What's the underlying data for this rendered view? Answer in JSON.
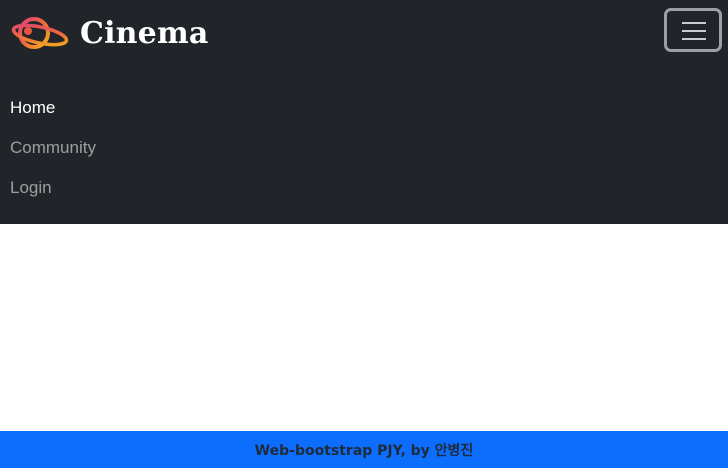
{
  "navbar": {
    "brand_name": "Cinema",
    "logo_icon": "planet-logo-icon",
    "toggler_icon": "hamburger-menu-icon",
    "items": [
      {
        "label": "Home",
        "active": true
      },
      {
        "label": "Community",
        "active": false
      },
      {
        "label": "Login",
        "active": false
      }
    ]
  },
  "footer": {
    "text": "Web-bootstrap PJY, by 안병진"
  },
  "colors": {
    "navbar_bg": "#212529",
    "footer_bg": "#0d6efd",
    "active_link": "#ffffff",
    "inactive_link": "#9a9da0"
  }
}
